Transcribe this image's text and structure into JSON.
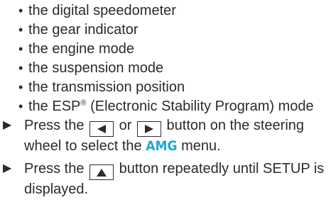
{
  "bullets": [
    "the digital speedometer",
    "the gear indicator",
    "the engine mode",
    "the suspension mode",
    "the transmission position",
    "the ESP",
    "(Electronic Stability Program) mode"
  ],
  "bullet_marker": "•",
  "esp_superscript": "®",
  "steps": {
    "step1": {
      "prefix": "Press the",
      "or": "or",
      "suffix_a": "button on the steering wheel to select the",
      "menu_name": "AMG",
      "suffix_b": "menu.",
      "left_key_icon": "triangle-left-icon",
      "right_key_icon": "triangle-right-icon"
    },
    "step2": {
      "prefix": "Press the",
      "suffix": "button repeatedly until SETUP is displayed.",
      "up_key_icon": "triangle-up-icon"
    },
    "marker": "▶"
  },
  "colors": {
    "text": "#2b2b2b",
    "amg_accent": "#1fa7d8"
  }
}
